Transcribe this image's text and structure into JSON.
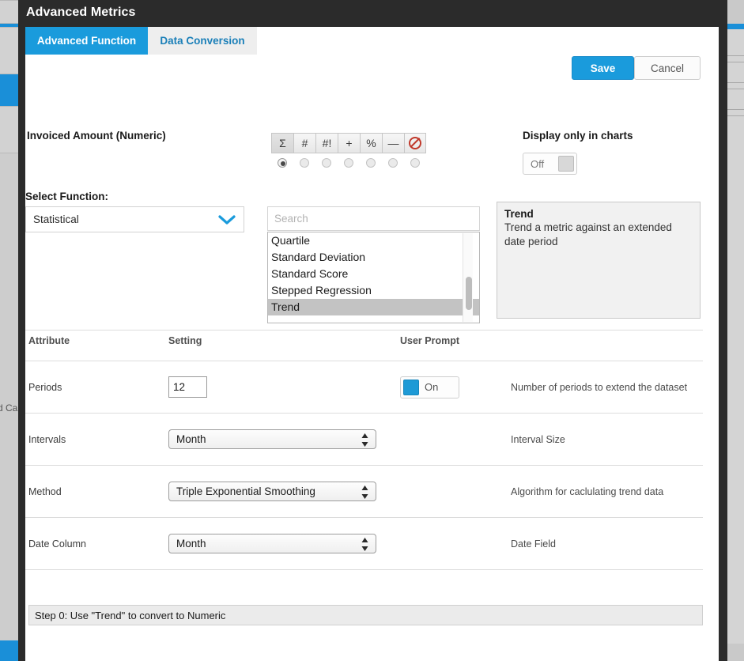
{
  "window": {
    "title": "Advanced Metrics"
  },
  "tabs": [
    {
      "label": "Advanced Function",
      "active": true
    },
    {
      "label": "Data Conversion",
      "active": false
    }
  ],
  "actions": {
    "save_label": "Save",
    "cancel_label": "Cancel"
  },
  "metric": {
    "name": "Invoiced Amount (Numeric)"
  },
  "operator_toolbar": {
    "buttons": [
      {
        "glyph": "Σ",
        "name": "sum-operator",
        "selected": true
      },
      {
        "glyph": "#",
        "name": "count-operator",
        "selected": false
      },
      {
        "glyph": "#!",
        "name": "count-distinct-operator",
        "selected": false
      },
      {
        "glyph": "+",
        "name": "plus-operator",
        "selected": false
      },
      {
        "glyph": "%",
        "name": "percent-operator",
        "selected": false
      },
      {
        "glyph": "—",
        "name": "minus-operator",
        "selected": false
      },
      {
        "glyph": "",
        "name": "none-operator",
        "selected": false
      }
    ]
  },
  "display_in_charts": {
    "label": "Display only in charts",
    "state": "Off"
  },
  "select_function": {
    "label": "Select Function:",
    "value": "Statistical"
  },
  "search": {
    "placeholder": "Search",
    "value": ""
  },
  "function_list": {
    "items": [
      {
        "label": "Quartile",
        "selected": false
      },
      {
        "label": "Standard Deviation",
        "selected": false
      },
      {
        "label": "Standard Score",
        "selected": false
      },
      {
        "label": "Stepped Regression",
        "selected": false
      },
      {
        "label": "Trend",
        "selected": true
      }
    ]
  },
  "description": {
    "title": "Trend",
    "text": "Trend a metric against an extended date period"
  },
  "attributes_table": {
    "headers": {
      "attribute": "Attribute",
      "setting": "Setting",
      "user_prompt": "User Prompt"
    },
    "rows": [
      {
        "attribute": "Periods",
        "setting_value": "12",
        "setting_type": "number",
        "prompt_state": "On",
        "has_prompt": true,
        "description": "Number of periods to extend the dataset"
      },
      {
        "attribute": "Intervals",
        "setting_value": "Month",
        "setting_type": "select",
        "prompt_state": "",
        "has_prompt": false,
        "description": "Interval Size"
      },
      {
        "attribute": "Method",
        "setting_value": "Triple Exponential Smoothing",
        "setting_type": "select",
        "prompt_state": "",
        "has_prompt": false,
        "description": "Algorithm for caclulating trend data"
      },
      {
        "attribute": "Date Column",
        "setting_value": "Month",
        "setting_type": "select",
        "prompt_state": "",
        "has_prompt": false,
        "description": "Date Field"
      }
    ]
  },
  "step_bar": {
    "text": "Step 0:  Use \"Trend\" to convert to Numeric"
  },
  "background": {
    "clipped_text": "d Ca"
  },
  "colors": {
    "accent": "#1a9bdc",
    "titlebar": "#2b2b2b",
    "selected_row": "#c3c3c3",
    "danger": "#c0392b"
  }
}
